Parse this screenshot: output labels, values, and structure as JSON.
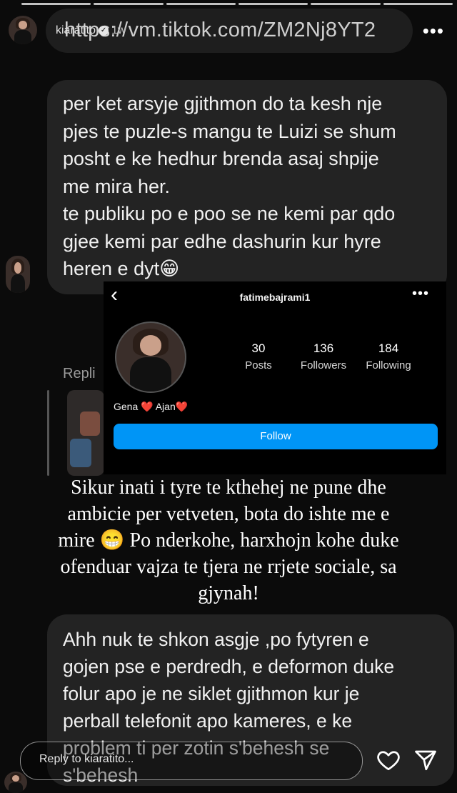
{
  "story": {
    "username": "kiaratito",
    "verified_mark": "✓",
    "time": "1w",
    "link": "https://vm.tiktok.com/ZM2Nj8YT2",
    "menu_icon": "more-dots-icon"
  },
  "comment1": {
    "lines": [
      "per ket arsyje gjithmon do ta kesh nje",
      "pjes te puzle-s mangu te Luizi se shum",
      "posht e ke hedhur brenda asaj shpije",
      "me mira her.",
      "te publiku po e poo se ne kemi par qdo",
      "gjee kemi par edhe dashurin kur hyre",
      "heren e dyt😁"
    ]
  },
  "reply_preview": {
    "label": "Repli"
  },
  "profile": {
    "username": "fatimebajrami1",
    "stats": [
      {
        "value": "30",
        "label": "Posts"
      },
      {
        "value": "136",
        "label": "Followers"
      },
      {
        "value": "184",
        "label": "Following"
      }
    ],
    "bio_name1": "Gena",
    "bio_name2": "Ajan",
    "heart": "❤️",
    "follow_button": "Follow"
  },
  "caption": {
    "lines": [
      "Sikur inati i tyre te kthehej ne pune dhe",
      "ambicie per vetveten, bota do ishte me e",
      "mire 😁 Po nderkohe, harxhojn kohe duke",
      "ofenduar vajza te tjera ne rrjete sociale, sa",
      "gjynah!"
    ]
  },
  "comment2": {
    "lines": [
      "Ahh nuk te shkon asgje ,po fytyren e",
      "gojen pse e perdredh, e deformon duke",
      "folur apo je ne siklet gjithmon kur je",
      "perball telefonit apo kameres, e ke",
      "problem  ti per zotin s'behesh se",
      "s'behesh"
    ]
  },
  "reply_input": {
    "placeholder": "Reply to kiaratito..."
  },
  "colors": {
    "follow_blue": "#0095f6",
    "bubble": "#232323",
    "heart_red": "#e0245e"
  }
}
